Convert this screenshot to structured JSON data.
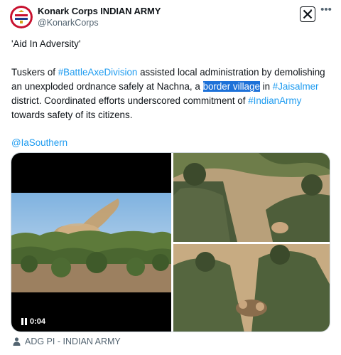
{
  "author": {
    "name": "Konark Corps INDIAN ARMY",
    "handle": "@KonarkCorps"
  },
  "tweet": {
    "title_line": "'Aid In Adversity'",
    "segments": [
      {
        "text": "Tuskers of ",
        "type": "text"
      },
      {
        "text": "#BattleAxeDivision",
        "type": "hashtag"
      },
      {
        "text": " assisted local administration by demolishing an unexploded ordnance safely at Nachna, a ",
        "type": "text"
      },
      {
        "text": "border village",
        "type": "highlight"
      },
      {
        "text": " in ",
        "type": "text"
      },
      {
        "text": "#Jaisalmer",
        "type": "hashtag"
      },
      {
        "text": " district. Coordinated efforts underscored commitment of ",
        "type": "text"
      },
      {
        "text": "#IndianArmy",
        "type": "hashtag"
      },
      {
        "text": " towards safety of its citizens.",
        "type": "text"
      }
    ],
    "mention": "@IaSouthern"
  },
  "media": {
    "video_duration": "0:04"
  },
  "source_label": "ADG PI - INDIAN ARMY",
  "icons": {
    "avatar": "army-emblem-icon",
    "platform": "x-logo-icon",
    "menu": "more-options-icon",
    "video_state": "pause-icon",
    "source": "person-icon"
  },
  "colors": {
    "link": "#1d9bf0",
    "highlight": "#1d71d8",
    "secondary_text": "#536471"
  }
}
